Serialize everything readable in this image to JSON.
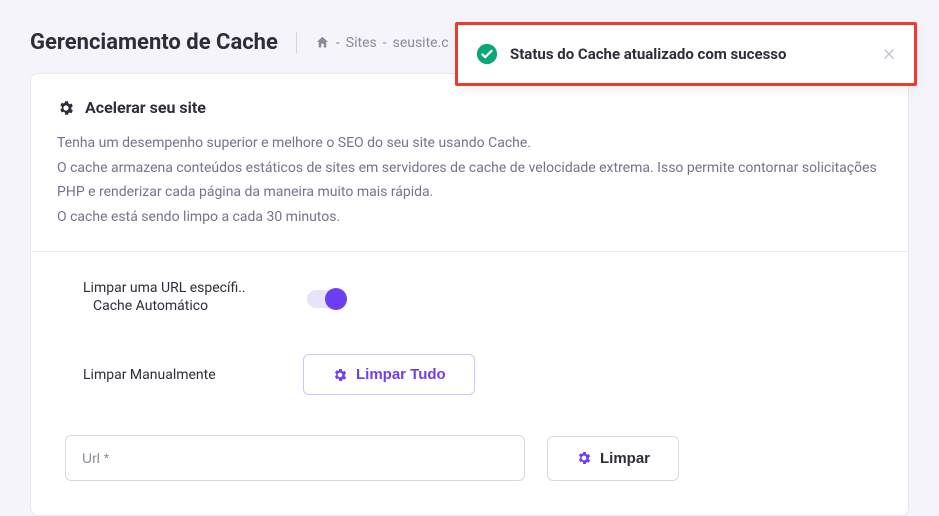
{
  "header": {
    "title": "Gerenciamento de Cache",
    "breadcrumb": {
      "item1": "Sites",
      "item2": "seusite.c"
    }
  },
  "card": {
    "title": "Acelerar seu site",
    "desc_line1": "Tenha um desempenho superior e melhore o SEO do seu site usando Cache.",
    "desc_line2": "O cache armazena conteúdos estáticos de sites em servidores de cache de velocidade extrema. Isso permite contornar solicitações PHP e renderizar cada página da maneira muito mais rápida.",
    "desc_line3": "O cache está sendo limpo a cada 30 minutos."
  },
  "controls": {
    "specific_url_label": "Limpar uma URL específi..",
    "auto_cache_label": "Cache Automático",
    "auto_cache_on": true,
    "manual_label": "Limpar Manualmente",
    "clear_all_label": "Limpar Tudo",
    "url_placeholder": "Url *",
    "clear_label": "Limpar"
  },
  "toast": {
    "message": "Status do Cache atualizado com sucesso"
  }
}
